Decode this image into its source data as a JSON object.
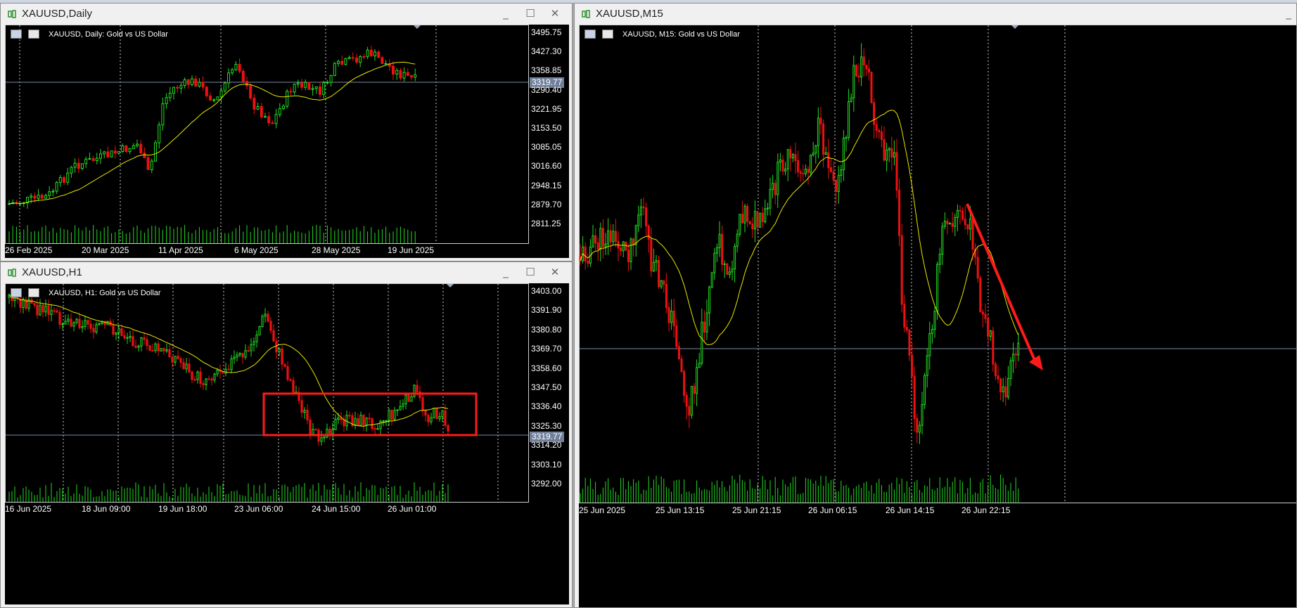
{
  "colors": {
    "bull": "#22dd22",
    "bear": "#ee1111",
    "ma": "#e8e800",
    "grid": "#cccccc",
    "bidline": "#7a8aa6",
    "annotation": "#ff1a1a",
    "background": "#000000"
  },
  "windows": {
    "daily": {
      "title": "XAUUSD,Daily",
      "chart_label": "XAUUSD, Daily:  Gold vs US Dollar",
      "price_ticks": [
        "3495.75",
        "3427.30",
        "3358.85",
        "3290.40",
        "3221.95",
        "3153.50",
        "3085.05",
        "3016.60",
        "2948.15",
        "2879.70",
        "2811.25"
      ],
      "date_ticks": [
        "26 Feb 2025",
        "20 Mar 2025",
        "11 Apr 2025",
        "6 May 2025",
        "28 May 2025",
        "19 Jun 2025"
      ],
      "current_price": "3319.77"
    },
    "h1": {
      "title": "XAUUSD,H1",
      "chart_label": "XAUUSD, H1:  Gold vs US Dollar",
      "price_ticks": [
        "3403.00",
        "3391.90",
        "3380.80",
        "3369.70",
        "3358.60",
        "3347.50",
        "3336.40",
        "3325.30",
        "3314.20",
        "3303.10",
        "3292.00"
      ],
      "date_ticks": [
        "16 Jun 2025",
        "18 Jun 09:00",
        "19 Jun 18:00",
        "23 Jun 06:00",
        "24 Jun 15:00",
        "26 Jun 01:00"
      ],
      "current_price": "3319.77"
    },
    "m15": {
      "title": "XAUUSD,M15",
      "chart_label": "XAUUSD, M15:  Gold vs US Dollar",
      "date_ticks": [
        "25 Jun 2025",
        "25 Jun 13:15",
        "25 Jun 21:15",
        "26 Jun 06:15",
        "26 Jun 14:15",
        "26 Jun 22:15"
      ]
    }
  },
  "icons": {
    "title": "candles-icon",
    "minimize": "minimize-icon",
    "maximize": "maximize-icon",
    "close": "close-icon"
  },
  "glyphs": {
    "minimize": "_",
    "maximize": "☐",
    "close": "✕"
  }
}
